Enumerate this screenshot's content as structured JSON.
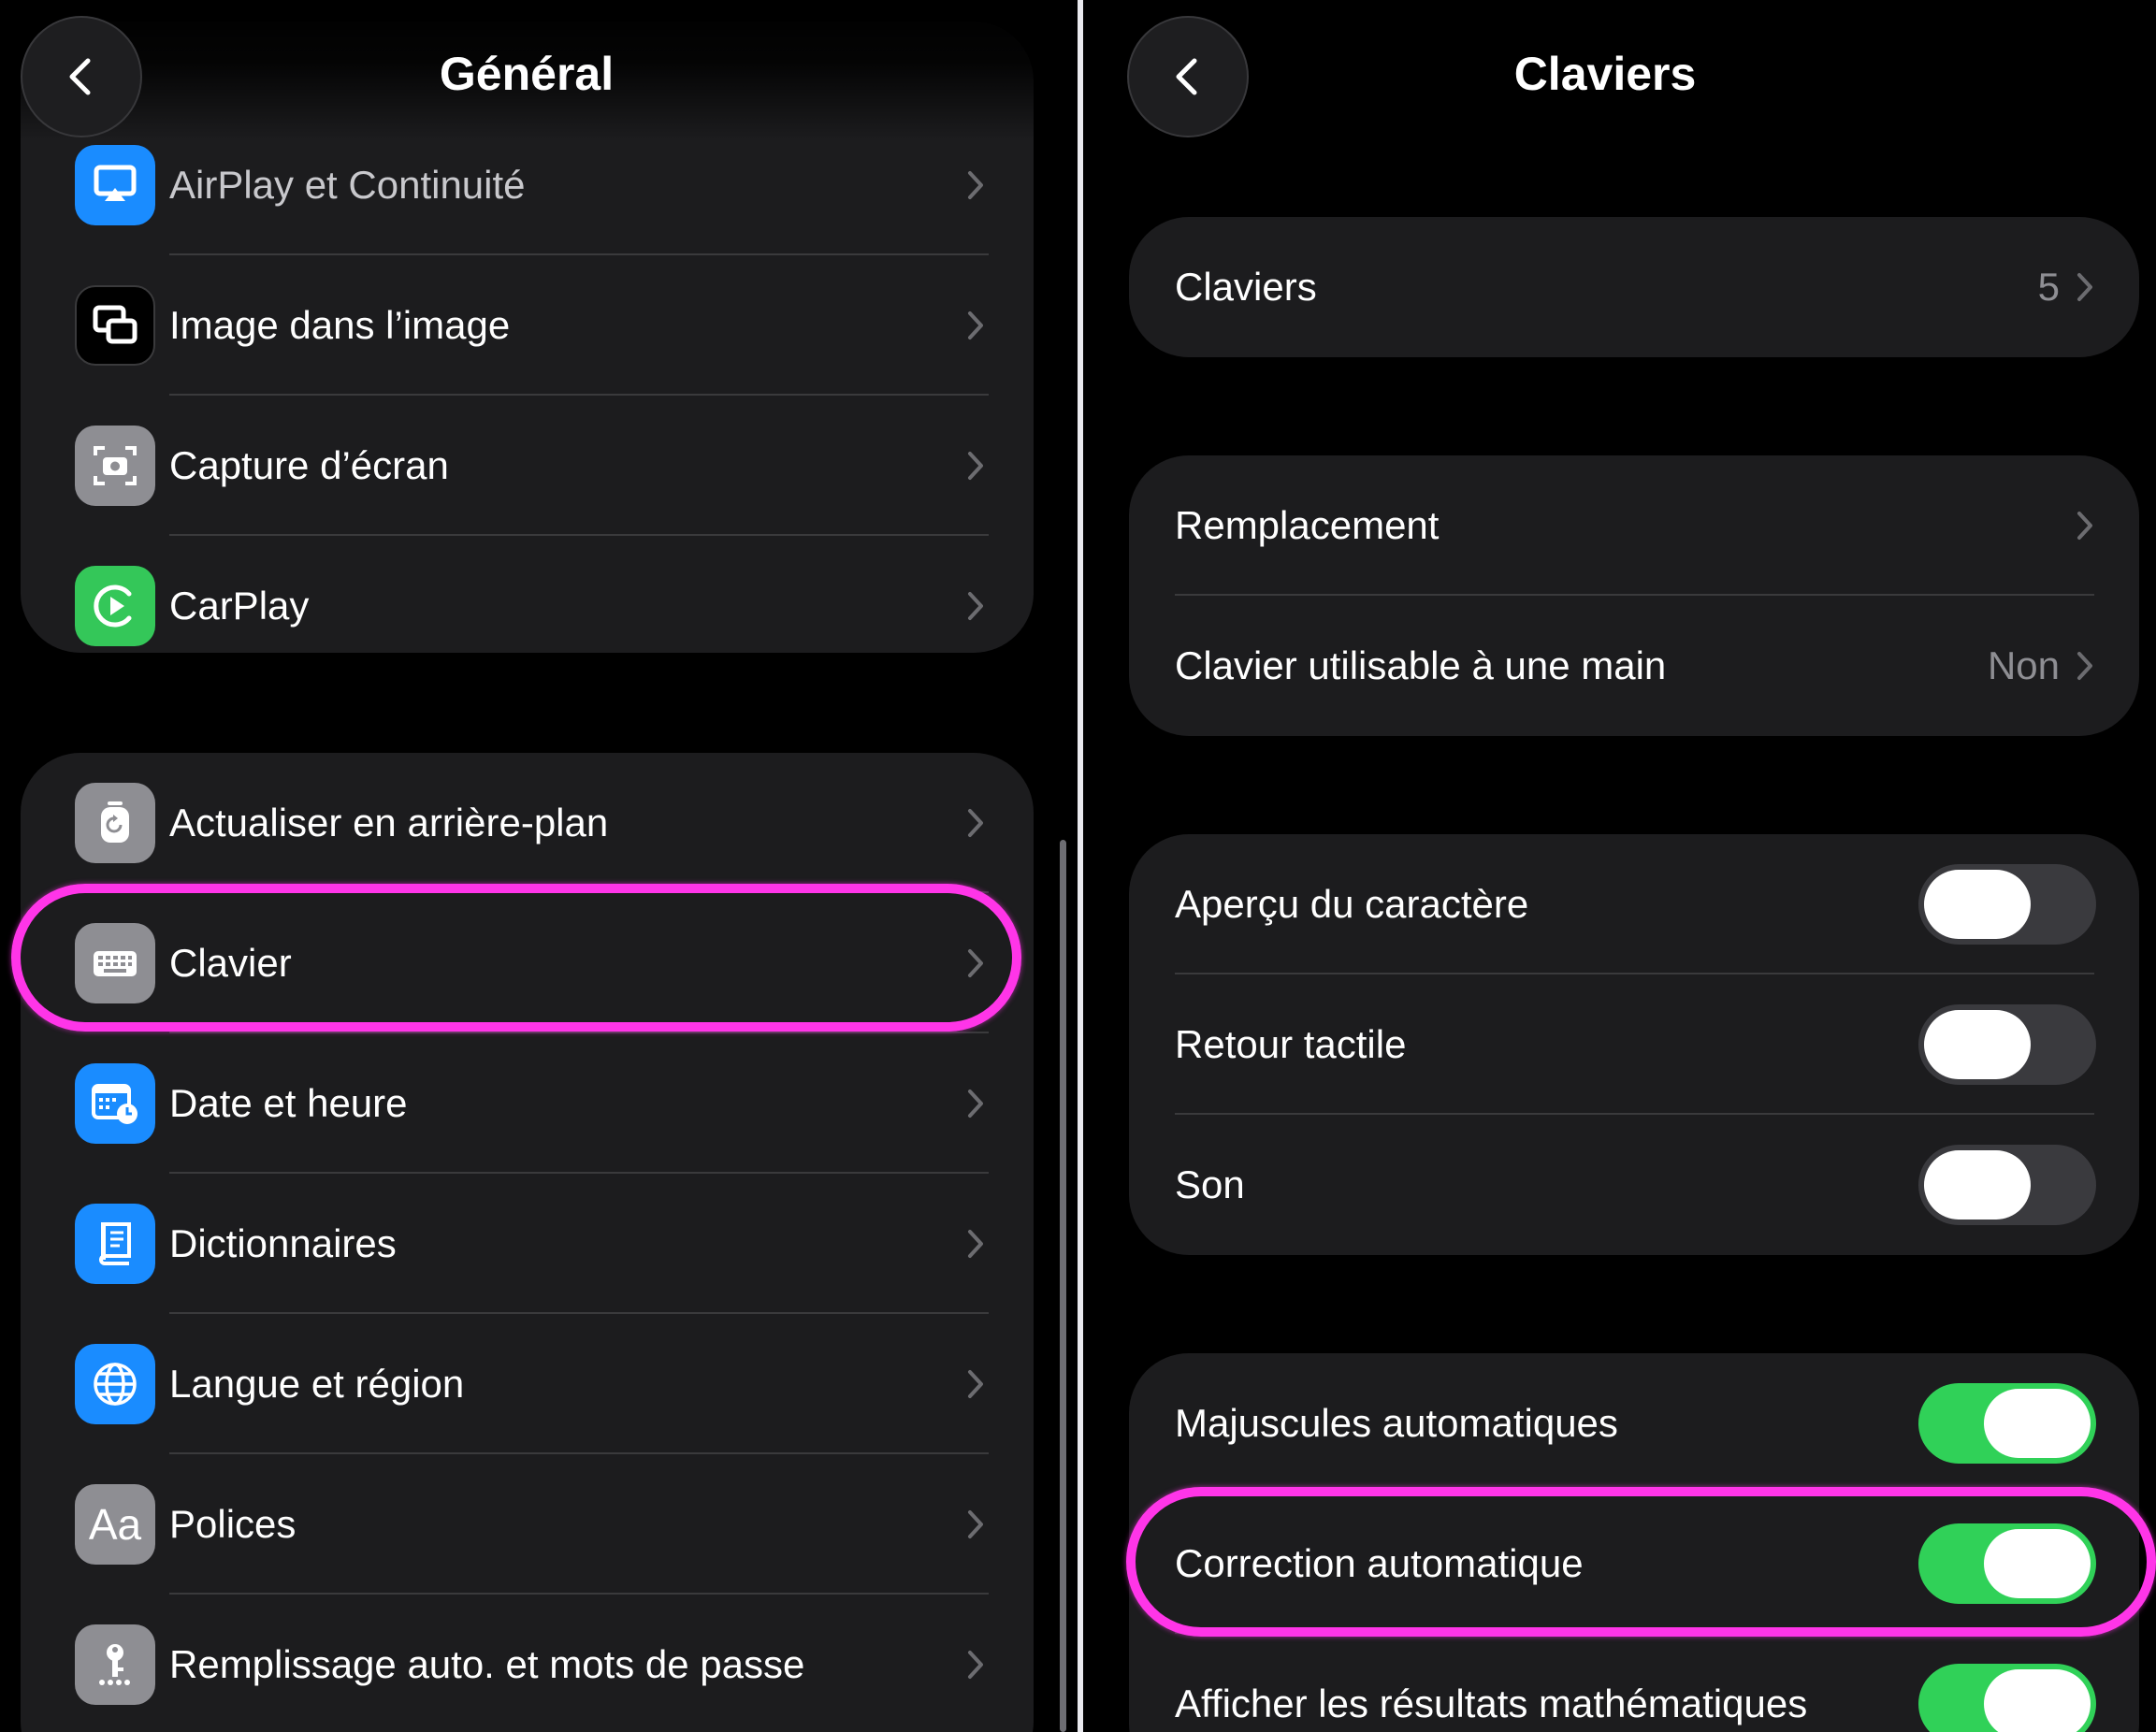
{
  "left": {
    "title": "Général",
    "group1": [
      {
        "label": "AirPlay et Continuité",
        "icon": "airplay-icon",
        "color": "#1a8cff"
      },
      {
        "label": "Image dans l’image",
        "icon": "picture-in-picture-icon",
        "color": "#000000"
      },
      {
        "label": "Capture d’écran",
        "icon": "screenshot-icon",
        "color": "#8e8e93"
      },
      {
        "label": "CarPlay",
        "icon": "carplay-icon",
        "color": "#34c759"
      }
    ],
    "group2": [
      {
        "label": "Actualiser en arrière-plan",
        "icon": "background-refresh-icon",
        "color": "#8e8e93"
      },
      {
        "label": "Clavier",
        "icon": "keyboard-icon",
        "color": "#8e8e93",
        "highlighted": true
      },
      {
        "label": "Date et heure",
        "icon": "calendar-clock-icon",
        "color": "#1a8cff"
      },
      {
        "label": "Dictionnaires",
        "icon": "dictionary-icon",
        "color": "#1a8cff"
      },
      {
        "label": "Langue et région",
        "icon": "globe-icon",
        "color": "#1a8cff"
      },
      {
        "label": "Polices",
        "icon": "fonts-icon",
        "color": "#8e8e93",
        "glyph": "Aa"
      },
      {
        "label": "Remplissage auto. et mots de passe",
        "icon": "passwords-key-icon",
        "color": "#8e8e93"
      }
    ]
  },
  "right": {
    "title": "Claviers",
    "claviers": {
      "label": "Claviers",
      "value": "5"
    },
    "group2": [
      {
        "label": "Remplacement",
        "value": ""
      },
      {
        "label": "Clavier utilisable à une main",
        "value": "Non"
      }
    ],
    "group3": [
      {
        "label": "Aperçu du caractère",
        "on": false
      },
      {
        "label": "Retour tactile",
        "on": false
      },
      {
        "label": "Son",
        "on": false
      }
    ],
    "group4": [
      {
        "label": "Majuscules automatiques",
        "on": true
      },
      {
        "label": "Correction automatique",
        "on": true,
        "highlighted": true
      },
      {
        "label": "Afficher les résultats mathématiques",
        "on": true
      }
    ]
  },
  "colors": {
    "highlight": "#ff35e8",
    "toggle_on": "#30d158",
    "toggle_off": "#3a3a3e",
    "group_bg": "#1c1c1e"
  }
}
